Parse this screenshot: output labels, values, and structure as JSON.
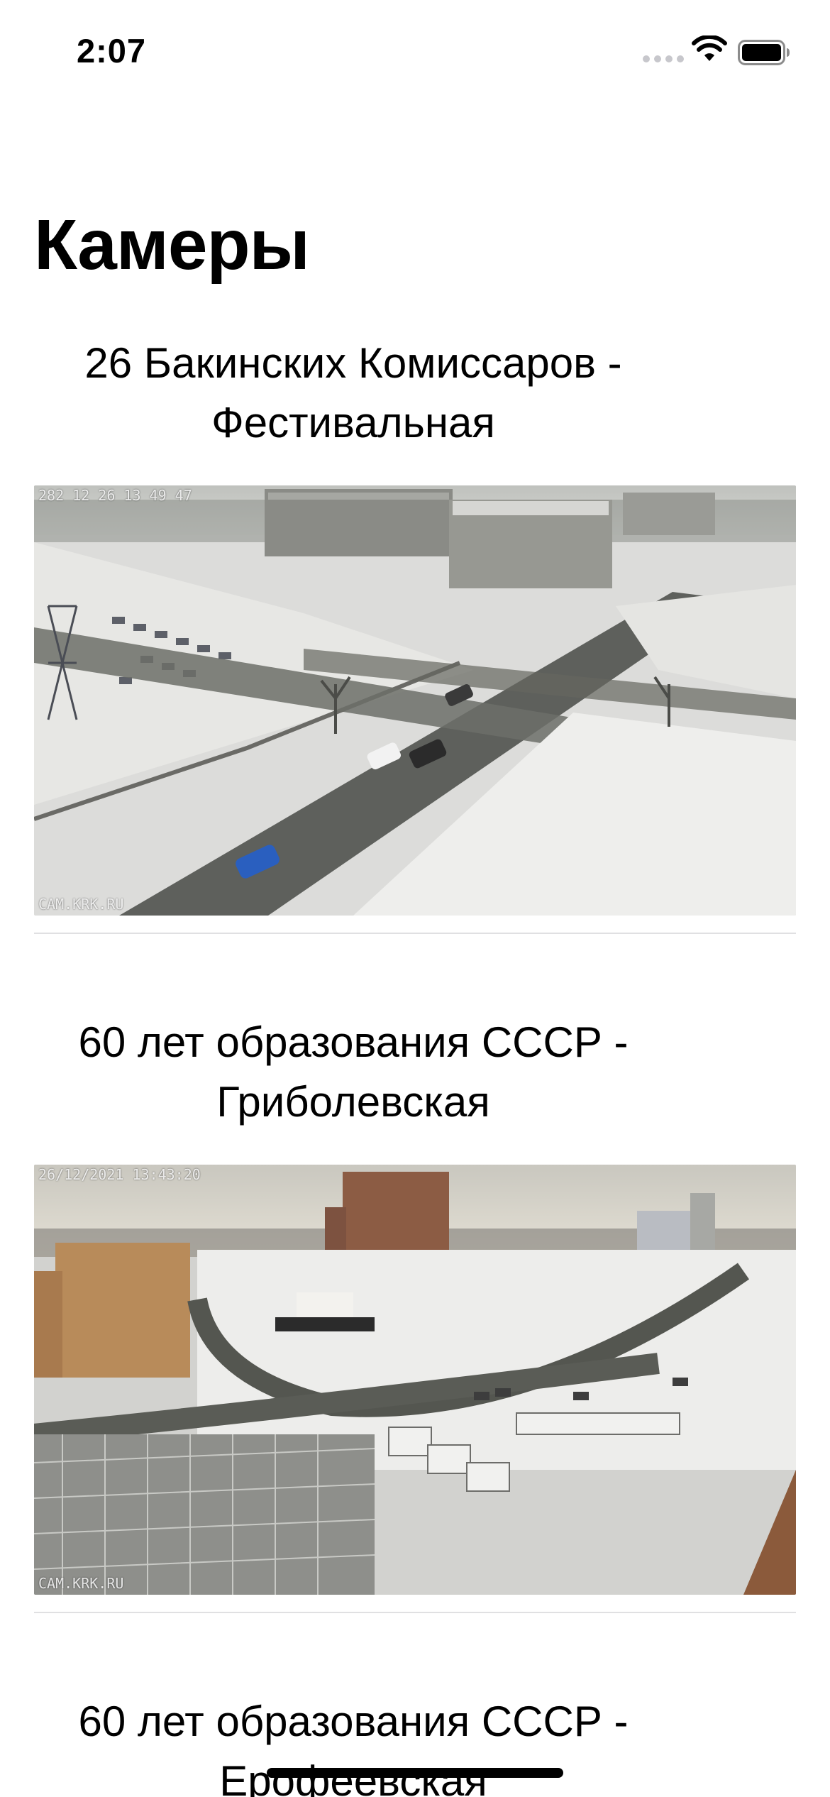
{
  "status_bar": {
    "time": "2:07",
    "icons": [
      "cellular-signal-icon",
      "wifi-icon",
      "battery-icon"
    ]
  },
  "page": {
    "title": "Камеры"
  },
  "cameras": [
    {
      "title_line1": "26 Бакинских Комиссаров -",
      "title_line2": "Фестивальная",
      "timestamp_overlay": "282 12 26 13 49 47",
      "watermark": "CAM.KRK.RU"
    },
    {
      "title_line1": "60 лет образования СССР -",
      "title_line2": "Гриболевская",
      "timestamp_overlay": "26/12/2021 13:43:20",
      "watermark": "CAM.KRK.RU"
    },
    {
      "title_line1": "60 лет образования СССР -",
      "title_line2": "Ерофеевская"
    }
  ],
  "colors": {
    "background": "#ffffff",
    "text": "#000000",
    "separator": "#e0e0e2"
  }
}
